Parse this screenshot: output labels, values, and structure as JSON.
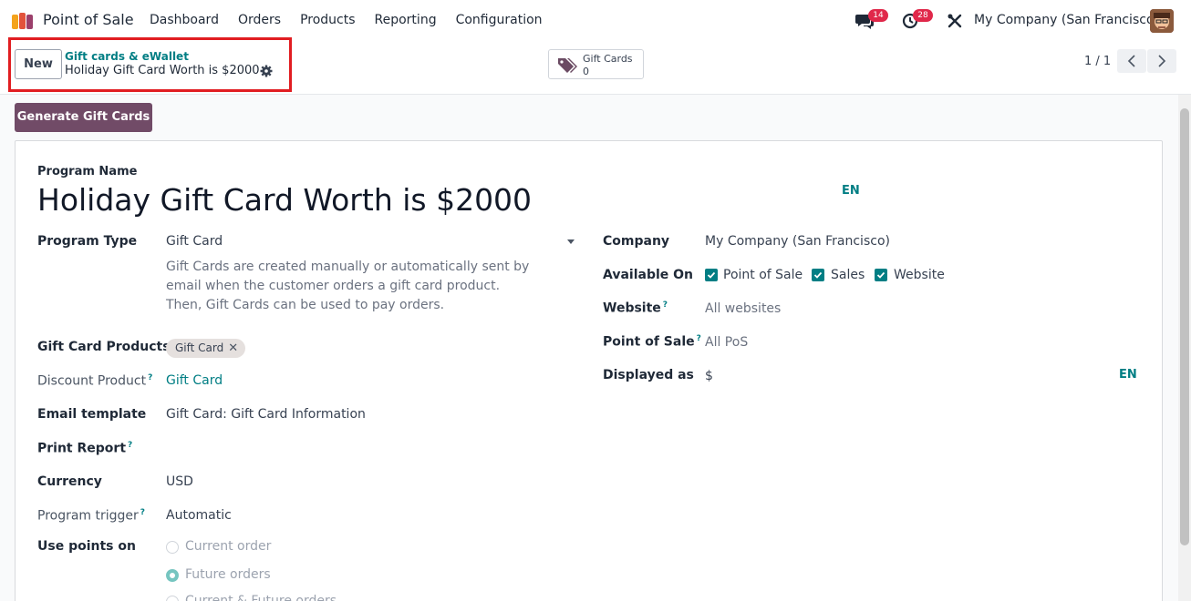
{
  "navbar": {
    "app_name": "Point of Sale",
    "menu": [
      "Dashboard",
      "Orders",
      "Products",
      "Reporting",
      "Configuration"
    ],
    "messages_count": "14",
    "activities_count": "28",
    "company": "My Company (San Francisco)"
  },
  "control": {
    "new_label": "New",
    "breadcrumb": "Gift cards & eWallet",
    "record_title": "Holiday Gift Card Worth is $2000",
    "smart_label": "Gift Cards",
    "smart_value": "0",
    "pager": "1 / 1"
  },
  "actions": {
    "generate": "Generate Gift Cards"
  },
  "form": {
    "program_name_label": "Program Name",
    "program_name": "Holiday Gift Card Worth is $2000",
    "lang": "EN",
    "program_type_label": "Program Type",
    "program_type": "Gift Card",
    "program_type_desc": "Gift Cards are created manually or automatically sent by email when the customer orders a gift card product.",
    "program_type_desc2": "Then, Gift Cards can be used to pay orders.",
    "gift_card_products_label": "Gift Card Products",
    "gift_card_tag": "Gift Card",
    "discount_product_label": "Discount Product",
    "discount_product": "Gift Card",
    "email_template_label": "Email template",
    "email_template": "Gift Card: Gift Card Information",
    "print_report_label": "Print Report",
    "currency_label": "Currency",
    "currency": "USD",
    "trigger_label": "Program trigger",
    "trigger": "Automatic",
    "use_points_label": "Use points on",
    "use_points_options": [
      "Current order",
      "Future orders",
      "Current & Future orders"
    ],
    "company_label": "Company",
    "company": "My Company (San Francisco)",
    "available_on_label": "Available On",
    "available_on": [
      "Point of Sale",
      "Sales",
      "Website"
    ],
    "website_label": "Website",
    "website": "All websites",
    "pos_label": "Point of Sale",
    "pos": "All PoS",
    "displayed_as_label": "Displayed as",
    "displayed_as": "$",
    "help_mark": "?"
  },
  "colors": {
    "primary": "#714b67",
    "accent": "#017e84",
    "badge": "#e0284a"
  }
}
